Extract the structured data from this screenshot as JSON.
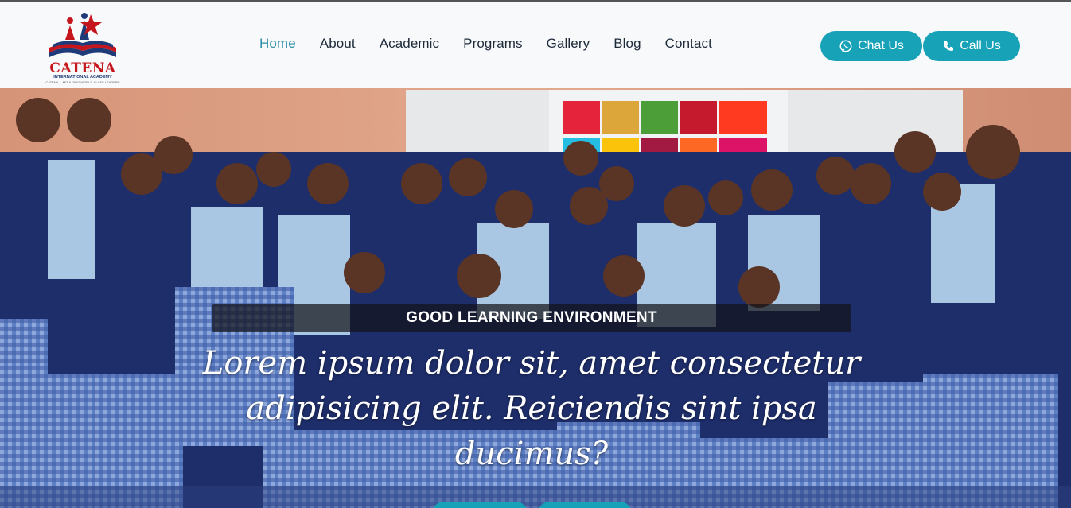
{
  "brand": {
    "name": "CATENA",
    "subtitle": "INTERNATIONAL ACADEMY",
    "tagline": "CATENA ... MOULDING WORLD-CLASS LEADERS"
  },
  "nav": {
    "items": [
      {
        "label": "Home",
        "active": true
      },
      {
        "label": "About",
        "active": false
      },
      {
        "label": "Academic",
        "active": false
      },
      {
        "label": "Programs",
        "active": false
      },
      {
        "label": "Gallery",
        "active": false
      },
      {
        "label": "Blog",
        "active": false
      },
      {
        "label": "Contact",
        "active": false
      }
    ]
  },
  "actions": {
    "chat_label": "Chat Us",
    "chat_icon": "whatsapp-icon",
    "call_label": "Call Us",
    "call_icon": "phone-icon"
  },
  "hero": {
    "badge": "GOOD LEARNING ENVIRONMENT",
    "headline": "Lorem ipsum dolor sit, amet consectetur adipisicing elit. Reiciendis sint ipsa ducimus?"
  },
  "colors": {
    "accent": "#17a2b8",
    "nav_active": "#2b8fa8",
    "nav_text": "#1d2a3a",
    "brand_red": "#c5161d",
    "brand_blue": "#1f3a78"
  }
}
